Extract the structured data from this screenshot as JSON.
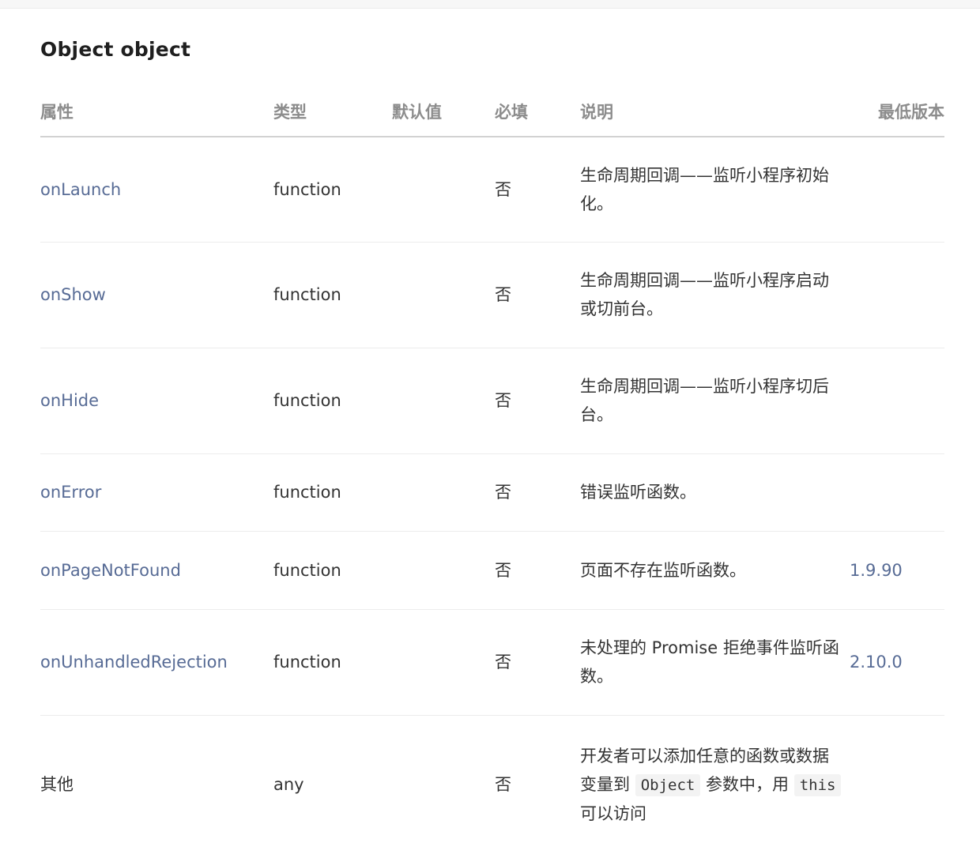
{
  "title": "Object object",
  "headers": {
    "attr": "属性",
    "type": "类型",
    "default": "默认值",
    "required": "必填",
    "desc": "说明",
    "version": "最低版本"
  },
  "rows": [
    {
      "attr": "onLaunch",
      "type": "function",
      "default": "",
      "required": "否",
      "desc": "生命周期回调——监听小程序初始化。",
      "version": ""
    },
    {
      "attr": "onShow",
      "type": "function",
      "default": "",
      "required": "否",
      "desc": "生命周期回调——监听小程序启动或切前台。",
      "version": ""
    },
    {
      "attr": "onHide",
      "type": "function",
      "default": "",
      "required": "否",
      "desc": "生命周期回调——监听小程序切后台。",
      "version": ""
    },
    {
      "attr": "onError",
      "type": "function",
      "default": "",
      "required": "否",
      "desc": "错误监听函数。",
      "version": ""
    },
    {
      "attr": "onPageNotFound",
      "type": "function",
      "default": "",
      "required": "否",
      "desc": "页面不存在监听函数。",
      "version": "1.9.90"
    },
    {
      "attr": "onUnhandledRejection",
      "type": "function",
      "default": "",
      "required": "否",
      "desc": "未处理的 Promise 拒绝事件监听函数。",
      "version": "2.10.0"
    },
    {
      "attr": "其他",
      "type": "any",
      "default": "",
      "required": "否",
      "desc": "",
      "version": "",
      "desc_parts": {
        "p1": "开发者可以添加任意的函数或数据变量到",
        "code1": "Object",
        "p2": "参数中，用",
        "code2": "this",
        "p3": "可以访问"
      }
    }
  ],
  "colors": {
    "link": "#576b95",
    "header_text": "#8c8c8c",
    "body_text": "#333333",
    "row_border": "#ececec",
    "header_border": "#d2d2d2"
  }
}
